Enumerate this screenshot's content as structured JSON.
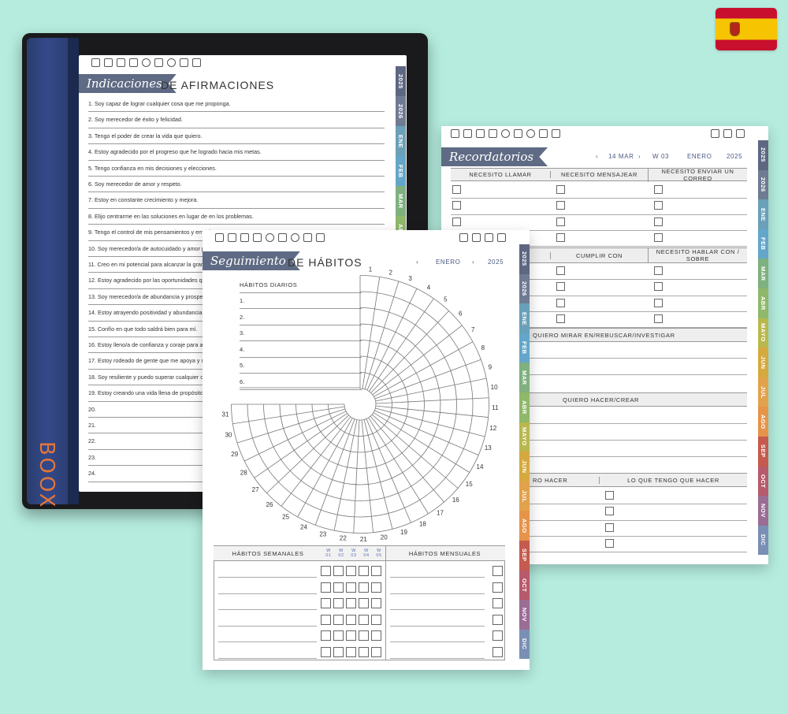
{
  "flag_icon": "spain-flag",
  "device": {
    "brand": "BOOX"
  },
  "afirmaciones": {
    "ribbon": "Indicaciones",
    "title": "DE AFIRMACIONES",
    "items": [
      "1. Soy capaz de lograr cualquier cosa que me proponga.",
      "2. Soy merecedor de éxito y felicidad.",
      "3. Tengo el poder de crear la vida que quiero.",
      "4. Estoy agradecido por el progreso que he logrado hacia mis metas.",
      "5. Tengo confianza en mis decisiones y elecciones.",
      "6. Soy merecedor de amor y respeto.",
      "7. Estoy en constante crecimiento y mejora.",
      "8. Elijo centrarme en las soluciones en lugar de en los problemas.",
      "9. Tengo el control de mis pensamientos y emociones.",
      "10. Soy merecedor/a de autocuidado y amor propio.",
      "11. Creo en mi potencial para alcanzar la grandeza.",
      "12. Estoy agradecido por las oportunidades que se me presentan.",
      "13. Soy merecedor/a de abundancia y prosperidad.",
      "14. Estoy atrayendo positividad y abundancia a mi vida.",
      "15. Confío en que todo saldrá bien para mí.",
      "16. Estoy lleno/a de confianza y coraje para afrontar desafíos.",
      "17. Estoy rodeado de gente que me apoya y me anima.",
      "18. Soy resiliente y puedo superar cualquier obstáculo.",
      "19. Estoy creando una vida llena de propósito y pasión.",
      "20.",
      "21.",
      "22.",
      "23.",
      "24."
    ]
  },
  "tabs": [
    "2025",
    "2026",
    "ENE",
    "FEB",
    "MAR",
    "ABR",
    "MAYO",
    "JUN",
    "JUL",
    "AGO",
    "SEP",
    "OCT",
    "NOV",
    "DIC"
  ],
  "tab_colors": [
    "#5d6782",
    "#6f7a93",
    "#6aa0b8",
    "#64a6c9",
    "#7fb07f",
    "#8fb86a",
    "#b8b84e",
    "#d6a93e",
    "#e2a24c",
    "#e6944a",
    "#c65a4e",
    "#b75a6b",
    "#9a6d95",
    "#7a8fb5"
  ],
  "recordatorios": {
    "ribbon": "Recordatorios",
    "nav_prev": "‹",
    "date": "14 MAR",
    "nav_next": "›",
    "week": "W 03",
    "month": "ENERO",
    "year": "2025",
    "col1": "NECESITO LLAMAR",
    "col2": "NECESITO MENSAJEAR",
    "col3": "NECESITO ENVIAR UN CORREO",
    "col4": "CUMPLIR CON",
    "col5": "NECESITO HABLAR CON / SOBRE",
    "sec1": "QUIERO MIRAR EN/REBUSCAR/INVESTIGAR",
    "sec2": "QUIERO HACER/CREAR",
    "sec3": "LO QUE QUIERO HACER",
    "sec3_visible": "RO HACER",
    "sec4": "LO QUE TENGO QUE HACER"
  },
  "habitos": {
    "ribbon": "Seguimiento",
    "title": "DE HÁBITOS",
    "nav_prev": "‹",
    "month": "ENERO",
    "nav_next": "›",
    "year": "2025",
    "daily_label": "HÁBITOS DIARIOS",
    "daily_rows": [
      "1.",
      "2.",
      "3.",
      "4.",
      "5.",
      "6."
    ],
    "days": [
      "1",
      "2",
      "3",
      "4",
      "5",
      "6",
      "7",
      "8",
      "9",
      "10",
      "11",
      "12",
      "13",
      "14",
      "15",
      "16",
      "17",
      "18",
      "19",
      "20",
      "21",
      "22",
      "23",
      "24",
      "25",
      "26",
      "27",
      "28",
      "29",
      "30",
      "31"
    ],
    "weekly_label": "HÁBITOS SEMANALES",
    "monthly_label": "HÁBITOS MENSUALES",
    "weeks": [
      "W 01",
      "W 02",
      "W 03",
      "W 04",
      "W 05"
    ]
  }
}
